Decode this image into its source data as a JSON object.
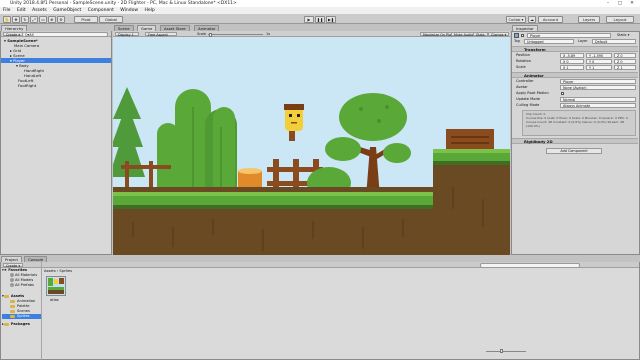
{
  "window": {
    "title": "Unity 2018.4.8f1 Personal - SampleScene.unity - 2D Flighter - PC, Mac & Linux Standalone* <DX11>"
  },
  "menu": [
    "File",
    "Edit",
    "Assets",
    "GameObject",
    "Component",
    "Window",
    "Help"
  ],
  "toolbar": {
    "pivot_label": "Pivot",
    "global_label": "Global",
    "collab_label": "Collab ▾",
    "account_label": "Account",
    "layers_label": "Layers",
    "layout_label": "Layout"
  },
  "hierarchy": {
    "tab": "Hierarchy",
    "create_label": "Create ▾",
    "search_placeholder": "Q▾All",
    "items": [
      {
        "label": "SampleScene*",
        "level": 0
      },
      {
        "label": "Main Camera",
        "level": 1
      },
      {
        "label": "Grid",
        "level": 1
      },
      {
        "label": "Scene",
        "level": 1
      },
      {
        "label": "Player",
        "level": 1
      },
      {
        "label": "Body",
        "level": 2
      },
      {
        "label": "HandRight",
        "level": 3
      },
      {
        "label": "HandLeft",
        "level": 3
      },
      {
        "label": "FootLeft",
        "level": 2
      },
      {
        "label": "FootRight",
        "level": 2
      }
    ]
  },
  "center_tabs": {
    "scene": "Scene",
    "game": "Game",
    "asset_store": "Asset Store",
    "animator": "Animator"
  },
  "game_bar": {
    "display": "Display 1",
    "aspect": "Free Aspect",
    "scale_label": "Scale",
    "scale_value": "1x",
    "maximize": "Maximize On Play",
    "mute": "Mute Audio",
    "stats": "Stats",
    "gizmos": "Gizmos ▾"
  },
  "inspector": {
    "tab": "Inspector",
    "object_name": "Player",
    "static_label": "Static ▾",
    "tag_label": "Tag",
    "tag_value": "Untagged",
    "layer_label": "Layer",
    "layer_value": "Default",
    "transform": {
      "title": "Transform",
      "position_label": "Position",
      "rotation_label": "Rotation",
      "scale_label": "Scale",
      "position": [
        "X -5.89",
        "Y -1.595",
        "Z 0"
      ],
      "rotation": [
        "X 0",
        "Y 0",
        "Z 0"
      ],
      "scale": [
        "X 1",
        "Y 1",
        "Z 1"
      ]
    },
    "animator": {
      "title": "Animator",
      "controller_label": "Controller",
      "controller_value": "Player",
      "avatar_label": "Avatar",
      "avatar_value": "None (Avatar)",
      "root_motion_label": "Apply Root Motion",
      "update_mode_label": "Update Mode",
      "update_mode_value": "Normal",
      "culling_mode_label": "Culling Mode",
      "culling_mode_value": "Always Animate",
      "info": "Clip Count: 0\nCurves Pos: 0 Quat: 0 Euler: 0 Scale: 0 Muscles: 0 Generic: 0 PPtr: 0\nCurves Count: 48 Constant: 0 (0.0%) Dense: 0 (0.0%) Stream: 48 (100.0%)"
    },
    "rigidbody_title": "Rigidbody 2D",
    "add_component": "Add Component"
  },
  "project": {
    "tab": "Project",
    "console_tab": "Console",
    "create_label": "Create ▾",
    "breadcrumb": "Assets › Sprites",
    "favorites_label": "Favorites",
    "favorites": [
      "All Materials",
      "All Models",
      "All Prefabs"
    ],
    "assets_label": "Assets",
    "asset_folders": [
      "Animation",
      "Palette",
      "Scenes",
      "Sprites"
    ],
    "packages_label": "Packages",
    "atlas_label": "atlas"
  },
  "colors": {
    "sky": "#cbe6f5",
    "grass": "#5fae2c",
    "dirt": "#6a4a22",
    "panel_bg": "#d6d6d6",
    "selected": "#3d80df"
  }
}
